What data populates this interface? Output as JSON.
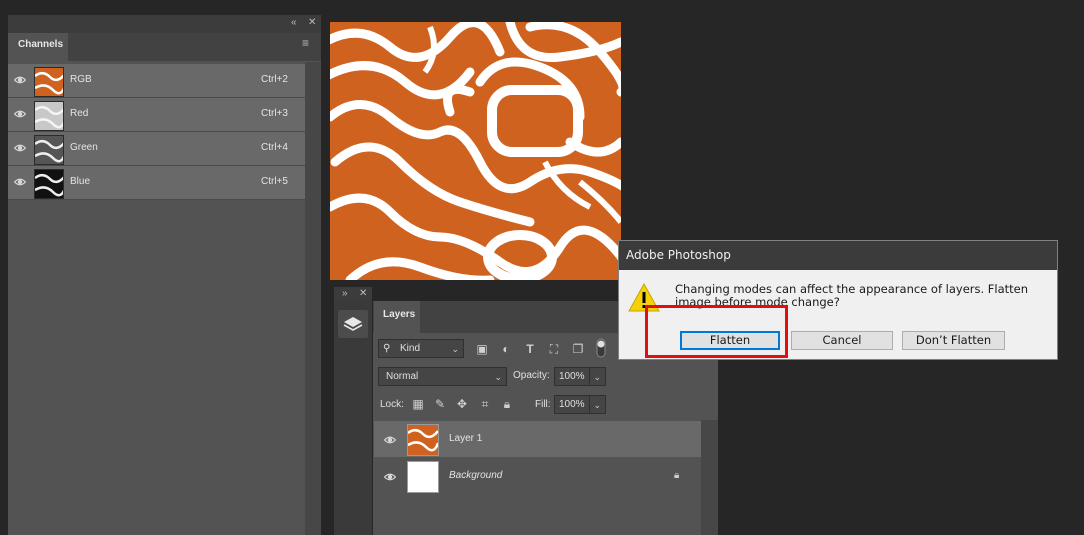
{
  "channels_panel": {
    "tab_label": "Channels",
    "collapse_icon": "double-chevron-left-icon",
    "close_icon": "close-icon",
    "menu_icon": "hamburger-menu-icon",
    "rows": [
      {
        "name": "RGB",
        "shortcut": "Ctrl+2"
      },
      {
        "name": "Red",
        "shortcut": "Ctrl+3"
      },
      {
        "name": "Green",
        "shortcut": "Ctrl+4"
      },
      {
        "name": "Blue",
        "shortcut": "Ctrl+5"
      }
    ]
  },
  "layers_panel": {
    "tab_label": "Layers",
    "filter_label": "Kind",
    "blend_mode": "Normal",
    "opacity_label": "Opacity:",
    "opacity_value": "100%",
    "lock_label": "Lock:",
    "fill_label": "Fill:",
    "fill_value": "100%",
    "layers": [
      {
        "name": "Layer 1"
      },
      {
        "name": "Background"
      }
    ]
  },
  "dialog": {
    "title": "Adobe Photoshop",
    "message": "Changing modes can affect the appearance of layers.  Flatten image before mode change?",
    "icon": "warning-icon",
    "buttons": {
      "flatten": "Flatten",
      "cancel": "Cancel",
      "dont_flatten": "Don’t Flatten"
    }
  },
  "colors": {
    "accent_orange": "#d0621f",
    "highlight_red": "#e01010",
    "focus_blue": "#0078d7"
  }
}
